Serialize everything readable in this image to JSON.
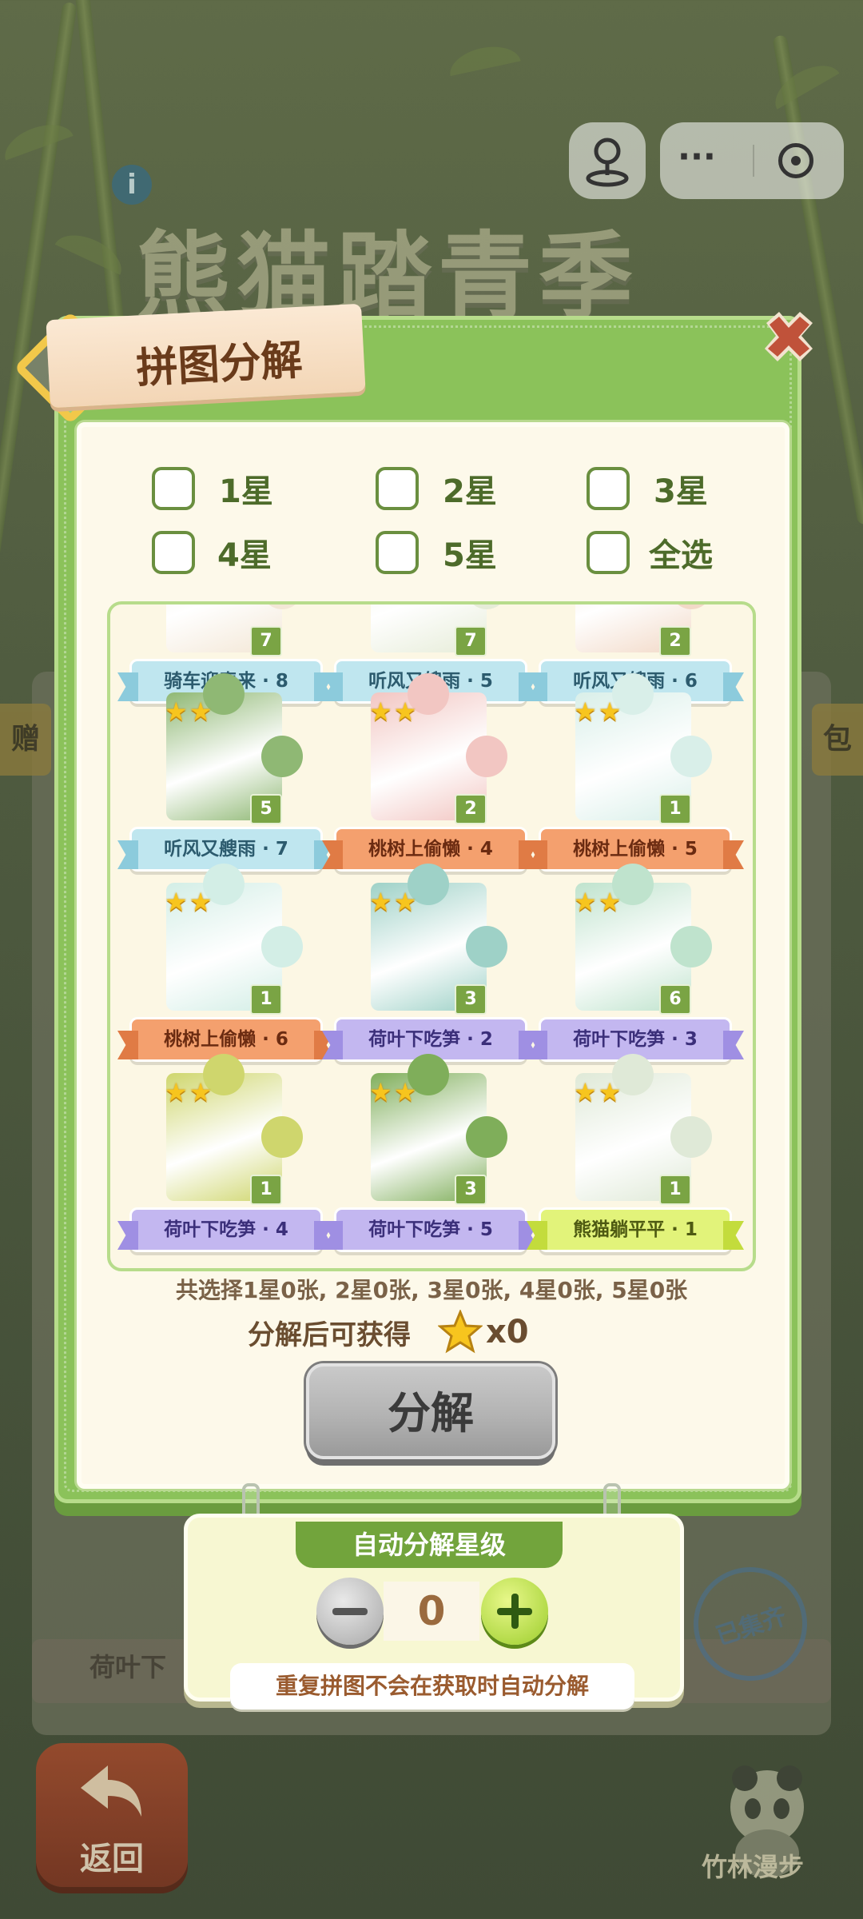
{
  "background": {
    "game_title": "熊猫踏青季",
    "left_banner": "赠",
    "right_banner": "包",
    "bottom_card_text": "荷叶下",
    "collected_stamp": "已集齐",
    "back_button": "返回",
    "walk_label": "竹林漫步"
  },
  "modal": {
    "title": "拼图分解",
    "filters": [
      {
        "label": "1星",
        "checked": false
      },
      {
        "label": "2星",
        "checked": false
      },
      {
        "label": "3星",
        "checked": false
      },
      {
        "label": "4星",
        "checked": false
      },
      {
        "label": "5星",
        "checked": false
      },
      {
        "label": "全选",
        "checked": false
      }
    ],
    "pieces": [
      {
        "name": "骑车迎春来 · 8",
        "count": "7",
        "stars": 0,
        "ribbon": "blue",
        "art": "#f3e7d6"
      },
      {
        "name": "听风又艘雨 · 5",
        "count": "7",
        "stars": 0,
        "ribbon": "blue",
        "art": "#e6ecd8"
      },
      {
        "name": "听风又艘雨 · 6",
        "count": "2",
        "stars": 0,
        "ribbon": "blue",
        "art": "#f2d9c7"
      },
      {
        "name": "听风又艘雨 · 7",
        "count": "5",
        "stars": 2,
        "ribbon": "blue",
        "art": "#8fb874"
      },
      {
        "name": "桃树上偷懒 · 4",
        "count": "2",
        "stars": 2,
        "ribbon": "orange",
        "art": "#f2c6c2"
      },
      {
        "name": "桃树上偷懒 · 5",
        "count": "1",
        "stars": 2,
        "ribbon": "orange",
        "art": "#d9efe9"
      },
      {
        "name": "桃树上偷懒 · 6",
        "count": "1",
        "stars": 2,
        "ribbon": "orange",
        "art": "#d3eee6"
      },
      {
        "name": "荷叶下吃笋 · 2",
        "count": "3",
        "stars": 2,
        "ribbon": "purple",
        "art": "#9ed1c7"
      },
      {
        "name": "荷叶下吃笋 · 3",
        "count": "6",
        "stars": 2,
        "ribbon": "purple",
        "art": "#bfe3cd"
      },
      {
        "name": "荷叶下吃笋 · 4",
        "count": "1",
        "stars": 2,
        "ribbon": "purple",
        "art": "#cfd66d"
      },
      {
        "name": "荷叶下吃笋 · 5",
        "count": "3",
        "stars": 2,
        "ribbon": "purple",
        "art": "#7fae5a"
      },
      {
        "name": "熊猫躺平平 · 1",
        "count": "1",
        "stars": 2,
        "ribbon": "lime",
        "art": "#dfe9d7"
      }
    ],
    "summary": "共选择1星0张, 2星0张, 3星0张, 4星0张, 5星0张",
    "reward_label": "分解后可获得",
    "reward_value": "x0",
    "decompose_button": "分解"
  },
  "auto_decompose": {
    "title": "自动分解星级",
    "value": "0",
    "note": "重复拼图不会在获取时自动分解"
  },
  "colors": {
    "modal_green": "#8bc25a",
    "accent_green": "#72a43c",
    "star_gold": "#f7c51e"
  }
}
